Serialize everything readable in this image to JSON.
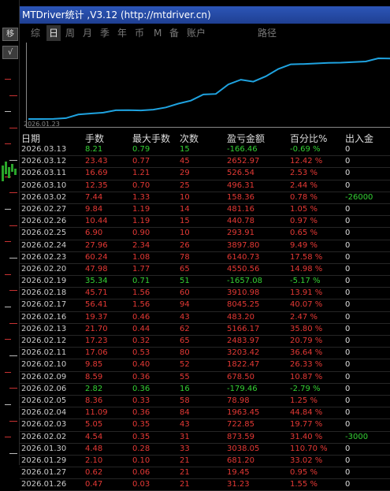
{
  "window": {
    "title": "MTDriver统计 ,V3.12 (http://mtdriver.cn)"
  },
  "left": {
    "btn1": "移",
    "btn2": "√"
  },
  "tabs": [
    "综",
    "日",
    "周",
    "月",
    "季",
    "年",
    "币",
    "M",
    "备",
    "账户",
    "路径"
  ],
  "active_tab": "日",
  "chart_data": {
    "type": "line",
    "start_label": "2026.01.23",
    "x": [
      "2026.01.23",
      "2026.01.26",
      "2026.01.27",
      "2026.01.29",
      "2026.01.30",
      "2026.02.02",
      "2026.02.03",
      "2026.02.04",
      "2026.02.05",
      "2026.02.06",
      "2026.02.09",
      "2026.02.10",
      "2026.02.11",
      "2026.02.12",
      "2026.02.13",
      "2026.02.16",
      "2026.02.17",
      "2026.02.18",
      "2026.02.19",
      "2026.02.20",
      "2026.02.23",
      "2026.02.24",
      "2026.02.25",
      "2026.02.26",
      "2026.02.27",
      "2026.03.02",
      "2026.03.10",
      "2026.03.11",
      "2026.03.12",
      "2026.03.13"
    ],
    "y": [
      0,
      31.23,
      50.68,
      731.88,
      3769.93,
      4643.52,
      5366.37,
      7329.82,
      7408.8,
      7229.34,
      7907.84,
      9730.31,
      12933.73,
      15417.7,
      20583.87,
      21066.07,
      29111.32,
      33021.92,
      31364.84,
      35915.4,
      42055.93,
      45953.73,
      46247.64,
      46688.42,
      47169.58,
      47327.94,
      47824.25,
      48350.79,
      51003.76,
      50837.3
    ],
    "grid": false
  },
  "table": {
    "headers": [
      "日期",
      "手数",
      "最大手数",
      "次数",
      "盈亏金额",
      "百分比%",
      "出入金"
    ],
    "rows": [
      {
        "date": "2026.03.13",
        "lots": "8.21",
        "max": "0.79",
        "count": "15",
        "pl": "-166.46",
        "pct": "-0.69 %",
        "io": "0",
        "color": "green"
      },
      {
        "date": "2026.03.12",
        "lots": "23.43",
        "max": "0.77",
        "count": "45",
        "pl": "2652.97",
        "pct": "12.42 %",
        "io": "0",
        "color": "red"
      },
      {
        "date": "2026.03.11",
        "lots": "16.69",
        "max": "1.21",
        "count": "29",
        "pl": "526.54",
        "pct": "2.53 %",
        "io": "0",
        "color": "red"
      },
      {
        "date": "2026.03.10",
        "lots": "12.35",
        "max": "0.70",
        "count": "25",
        "pl": "496.31",
        "pct": "2.44 %",
        "io": "0",
        "color": "red"
      },
      {
        "date": "2026.03.02",
        "lots": "7.44",
        "max": "1.33",
        "count": "10",
        "pl": "158.36",
        "pct": "0.78 %",
        "io": "-26000",
        "color": "red"
      },
      {
        "date": "2026.02.27",
        "lots": "9.84",
        "max": "1.19",
        "count": "14",
        "pl": "481.16",
        "pct": "1.05 %",
        "io": "0",
        "color": "red"
      },
      {
        "date": "2026.02.26",
        "lots": "10.44",
        "max": "1.19",
        "count": "15",
        "pl": "440.78",
        "pct": "0.97 %",
        "io": "0",
        "color": "red"
      },
      {
        "date": "2026.02.25",
        "lots": "6.90",
        "max": "0.90",
        "count": "10",
        "pl": "293.91",
        "pct": "0.65 %",
        "io": "0",
        "color": "red"
      },
      {
        "date": "2026.02.24",
        "lots": "27.96",
        "max": "2.34",
        "count": "26",
        "pl": "3897.80",
        "pct": "9.49 %",
        "io": "0",
        "color": "red"
      },
      {
        "date": "2026.02.23",
        "lots": "60.24",
        "max": "1.08",
        "count": "78",
        "pl": "6140.73",
        "pct": "17.58 %",
        "io": "0",
        "color": "red"
      },
      {
        "date": "2026.02.20",
        "lots": "47.98",
        "max": "1.77",
        "count": "65",
        "pl": "4550.56",
        "pct": "14.98 %",
        "io": "0",
        "color": "red"
      },
      {
        "date": "2026.02.19",
        "lots": "35.34",
        "max": "0.71",
        "count": "51",
        "pl": "-1657.08",
        "pct": "-5.17 %",
        "io": "0",
        "color": "green"
      },
      {
        "date": "2026.02.18",
        "lots": "45.71",
        "max": "1.56",
        "count": "60",
        "pl": "3910.98",
        "pct": "13.91 %",
        "io": "0",
        "color": "red"
      },
      {
        "date": "2026.02.17",
        "lots": "56.41",
        "max": "1.56",
        "count": "94",
        "pl": "8045.25",
        "pct": "40.07 %",
        "io": "0",
        "color": "red"
      },
      {
        "date": "2026.02.16",
        "lots": "19.37",
        "max": "0.46",
        "count": "43",
        "pl": "483.20",
        "pct": "2.47 %",
        "io": "0",
        "color": "red"
      },
      {
        "date": "2026.02.13",
        "lots": "21.70",
        "max": "0.44",
        "count": "62",
        "pl": "5166.17",
        "pct": "35.80 %",
        "io": "0",
        "color": "red"
      },
      {
        "date": "2026.02.12",
        "lots": "17.23",
        "max": "0.32",
        "count": "65",
        "pl": "2483.97",
        "pct": "20.79 %",
        "io": "0",
        "color": "red"
      },
      {
        "date": "2026.02.11",
        "lots": "17.06",
        "max": "0.53",
        "count": "80",
        "pl": "3203.42",
        "pct": "36.64 %",
        "io": "0",
        "color": "red"
      },
      {
        "date": "2026.02.10",
        "lots": "9.85",
        "max": "0.40",
        "count": "52",
        "pl": "1822.47",
        "pct": "26.33 %",
        "io": "0",
        "color": "red"
      },
      {
        "date": "2026.02.09",
        "lots": "8.59",
        "max": "0.36",
        "count": "55",
        "pl": "678.50",
        "pct": "10.87 %",
        "io": "0",
        "color": "red"
      },
      {
        "date": "2026.02.06",
        "lots": "2.82",
        "max": "0.36",
        "count": "16",
        "pl": "-179.46",
        "pct": "-2.79 %",
        "io": "0",
        "color": "green"
      },
      {
        "date": "2026.02.05",
        "lots": "8.36",
        "max": "0.33",
        "count": "58",
        "pl": "78.98",
        "pct": "1.25 %",
        "io": "0",
        "color": "red"
      },
      {
        "date": "2026.02.04",
        "lots": "11.09",
        "max": "0.36",
        "count": "84",
        "pl": "1963.45",
        "pct": "44.84 %",
        "io": "0",
        "color": "red"
      },
      {
        "date": "2026.02.03",
        "lots": "5.05",
        "max": "0.35",
        "count": "43",
        "pl": "722.85",
        "pct": "19.77 %",
        "io": "0",
        "color": "red"
      },
      {
        "date": "2026.02.02",
        "lots": "4.54",
        "max": "0.35",
        "count": "31",
        "pl": "873.59",
        "pct": "31.40 %",
        "io": "-3000",
        "color": "red"
      },
      {
        "date": "2026.01.30",
        "lots": "4.48",
        "max": "0.28",
        "count": "33",
        "pl": "3038.05",
        "pct": "110.70 %",
        "io": "0",
        "color": "red"
      },
      {
        "date": "2026.01.29",
        "lots": "2.10",
        "max": "0.10",
        "count": "21",
        "pl": "681.20",
        "pct": "33.02 %",
        "io": "0",
        "color": "red"
      },
      {
        "date": "2026.01.27",
        "lots": "0.62",
        "max": "0.06",
        "count": "21",
        "pl": "19.45",
        "pct": "0.95 %",
        "io": "0",
        "color": "red"
      },
      {
        "date": "2026.01.26",
        "lots": "0.47",
        "max": "0.03",
        "count": "21",
        "pl": "31.23",
        "pct": "1.55 %",
        "io": "0",
        "color": "red"
      }
    ]
  },
  "colors": {
    "profit": "#e53935",
    "loss": "#34d134",
    "line": "#1fa3e0",
    "title_bar": "#2c56b8"
  }
}
